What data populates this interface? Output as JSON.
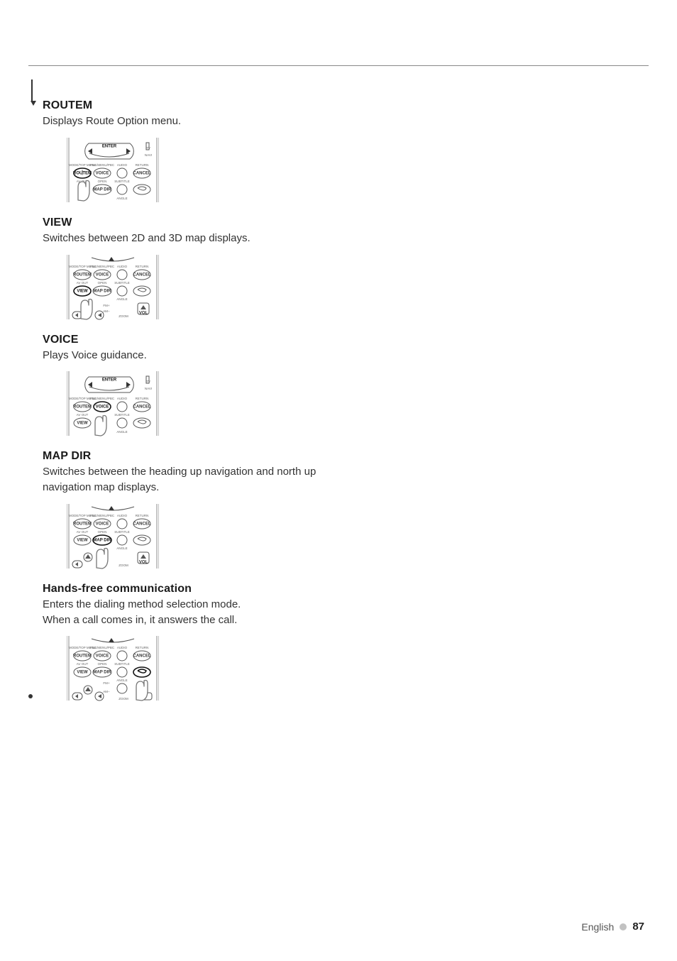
{
  "sections": [
    {
      "title": "ROUTEM",
      "desc": "Displays Route Option menu."
    },
    {
      "title": "VIEW",
      "desc": "Switches between 2D and 3D map displays."
    },
    {
      "title": "VOICE",
      "desc": "Plays Voice guidance."
    },
    {
      "title": "MAP DIR",
      "desc": "Switches between the heading up navigation and north up navigation map displays."
    },
    {
      "title": "Hands-free communication",
      "desc": "Enters the dialing method selection mode.\nWhen a call comes in, it answers the call."
    }
  ],
  "remote_labels": {
    "enter": "ENTER",
    "routem": "ROUTEM",
    "voice": "VOICE",
    "cancel": "CANCEL",
    "view": "VIEW",
    "mapdir": "MAP DIR",
    "vol": "VOL",
    "tv": "TV",
    "navi": "NAVI",
    "row_top": [
      "MODE/TOP MENU",
      "FNC/MENU/PBC",
      "AUDIO",
      "RETURN"
    ],
    "row_mid": [
      "AV OUT",
      "OPEN",
      "SUBTITLE"
    ],
    "angle": "ANGLE",
    "zoom": "ZOOM",
    "fm": "FM+",
    "am": "AM−",
    "phone": "phone-handset-icon"
  },
  "footer": {
    "lang": "English",
    "page": "87"
  }
}
